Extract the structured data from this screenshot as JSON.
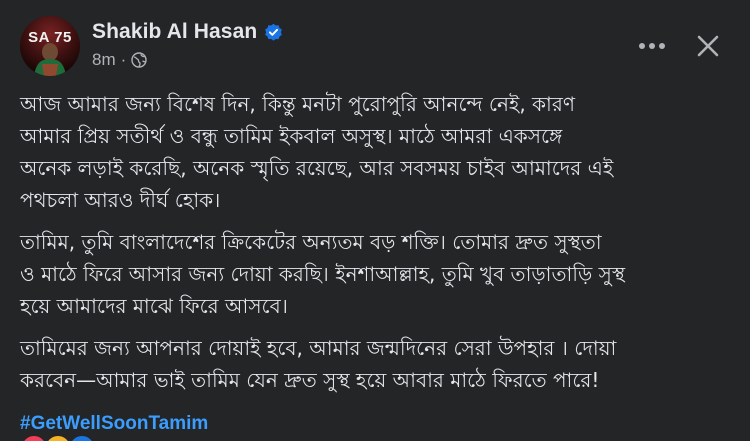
{
  "post": {
    "author": "Shakib Al Hasan",
    "verified": true,
    "timestamp": "8m",
    "separator": "·",
    "privacy_icon": "globe-icon",
    "avatar_text": "SA 75",
    "paragraphs": [
      "আজ আমার জন্য বিশেষ দিন, কিন্তু মনটা পুরোপুরি আনন্দে নেই, কারণ\nআমার প্রিয় সতীর্থ ও বন্ধু তামিম ইকবাল অসুস্থ। মাঠে আমরা একসঙ্গে\nঅনেক লড়াই করেছি, অনেক স্মৃতি রয়েছে, আর সবসময় চাইব আমাদের এই\nপথচলা আরও দীর্ঘ হোক।",
      "তামিম, তুমি বাংলাদেশের ক্রিকেটের অন্যতম বড় শক্তি। তোমার দ্রুত সুস্থতা\nও মাঠে ফিরে আসার জন্য দোয়া করছি। ইনশাআল্লাহ, তুমি খুব তাড়াতাড়ি সুস্থ\nহয়ে আমাদের মাঝে ফিরে আসবে।",
      "তামিমের জন্য আপনার দোয়াই হবে, আমার জন্মদিনের সেরা উপহার । দোয়া\nকরবেন—আমার ভাই তামিম যেন দ্রুত সুস্থ হয়ে আবার মাঠে ফিরতে পারে!"
    ],
    "hashtag": "#GetWellSoonTamim"
  },
  "actions": {
    "more_icon": "more-horizontal-icon",
    "close_icon": "close-icon"
  },
  "colors": {
    "background": "#242526",
    "text_primary": "#e4e6eb",
    "text_secondary": "#b0b3b8",
    "link": "#3b9eff",
    "verified": "#1b74e4"
  }
}
